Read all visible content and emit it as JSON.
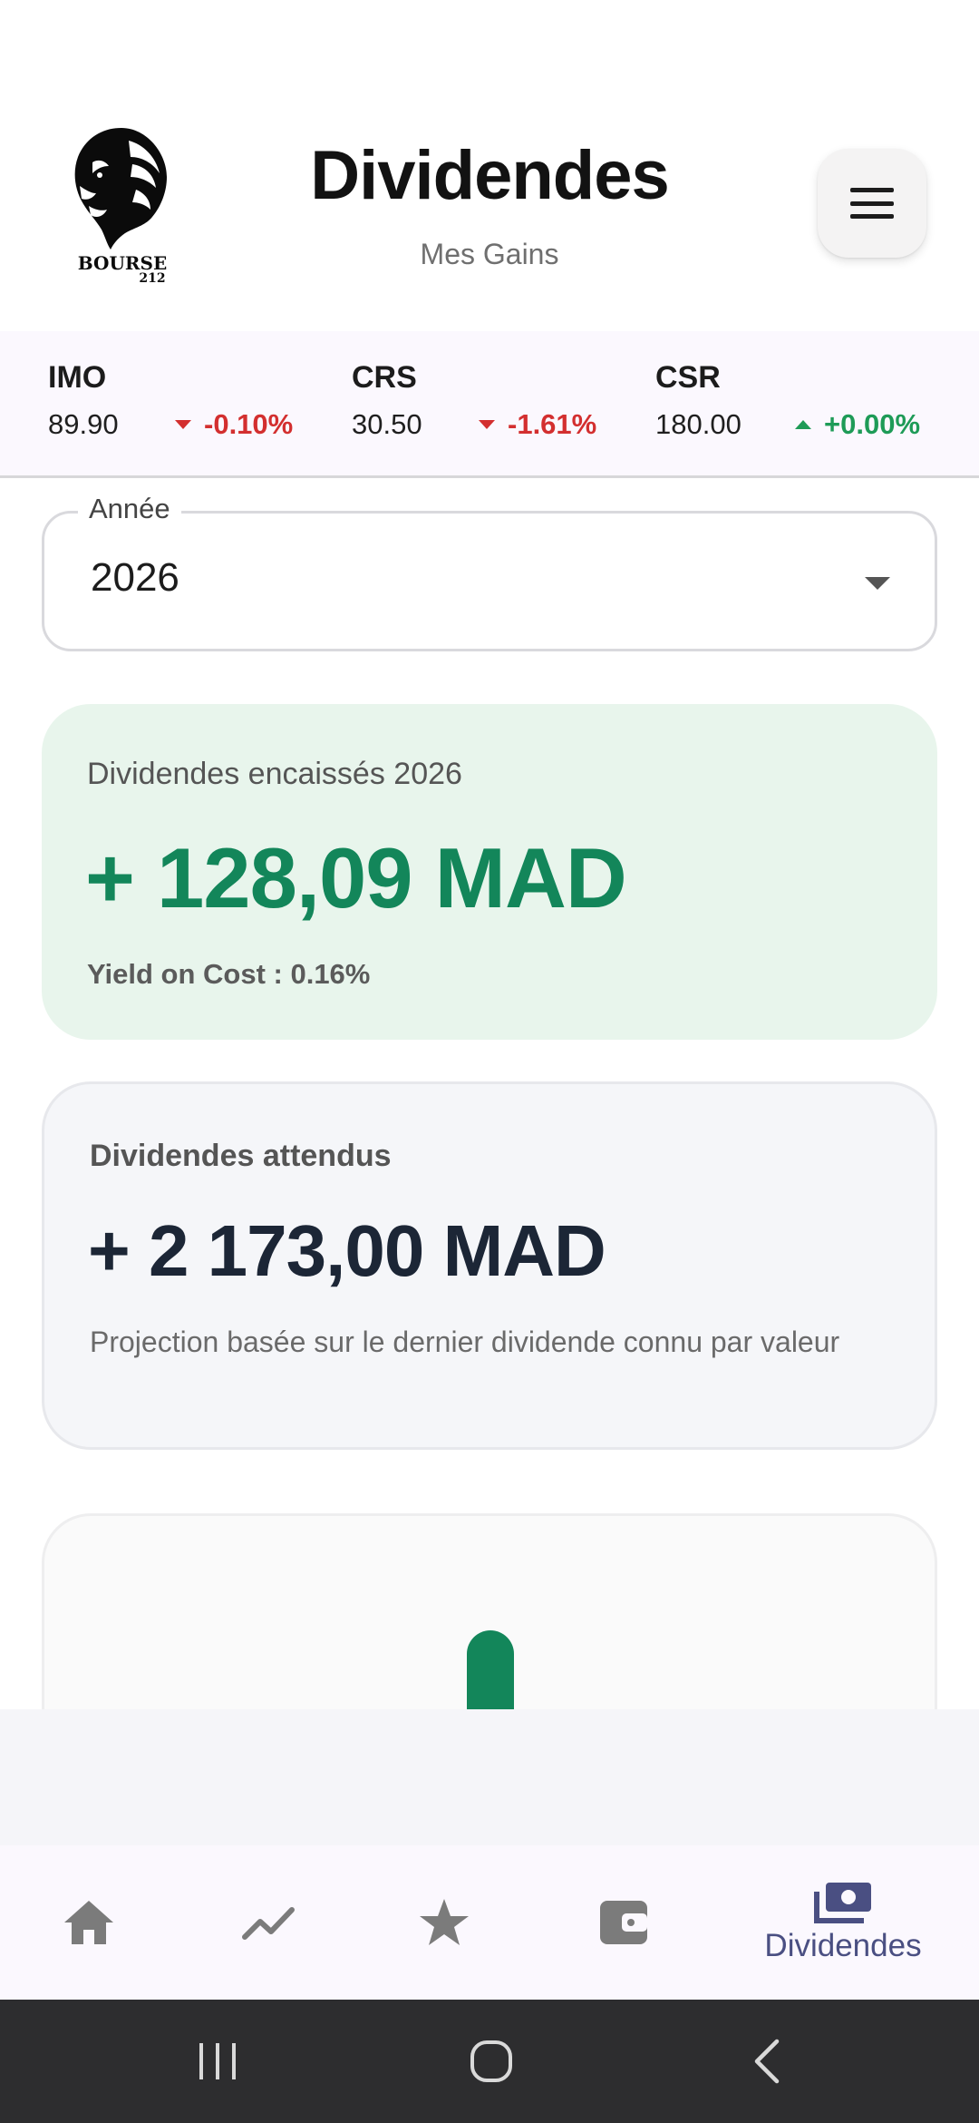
{
  "header": {
    "logo_text": "BOURSE 212",
    "title": "Dividendes",
    "subtitle": "Mes Gains",
    "menu_icon": "hamburger-menu-icon"
  },
  "ticker": [
    {
      "symbol": "IMO",
      "price": "89.90",
      "change": "-0.10%",
      "direction": "down"
    },
    {
      "symbol": "CRS",
      "price": "30.50",
      "change": "-1.61%",
      "direction": "down"
    },
    {
      "symbol": "CSR",
      "price": "180.00",
      "change": "+0.00%",
      "direction": "up"
    }
  ],
  "year_select": {
    "label": "Année",
    "value": "2026"
  },
  "received_card": {
    "label": "Dividendes encaissés 2026",
    "amount": "+ 128,09 MAD",
    "yield": "Yield on Cost : 0.16%"
  },
  "expected_card": {
    "label": "Dividendes attendus",
    "amount": "+ 2 173,00 MAD",
    "note": "Projection basée sur le dernier dividende connu par valeur"
  },
  "bottom_nav": {
    "items": [
      {
        "icon": "home-icon",
        "label": ""
      },
      {
        "icon": "trending-icon",
        "label": ""
      },
      {
        "icon": "star-icon",
        "label": ""
      },
      {
        "icon": "wallet-icon",
        "label": ""
      },
      {
        "icon": "payments-icon",
        "label": "Dividendes",
        "active": true
      }
    ]
  },
  "colors": {
    "accent_green": "#13865a",
    "loss_red": "#d32f2f",
    "gain_green": "#1e9b57",
    "nav_active": "#4a4f82"
  }
}
